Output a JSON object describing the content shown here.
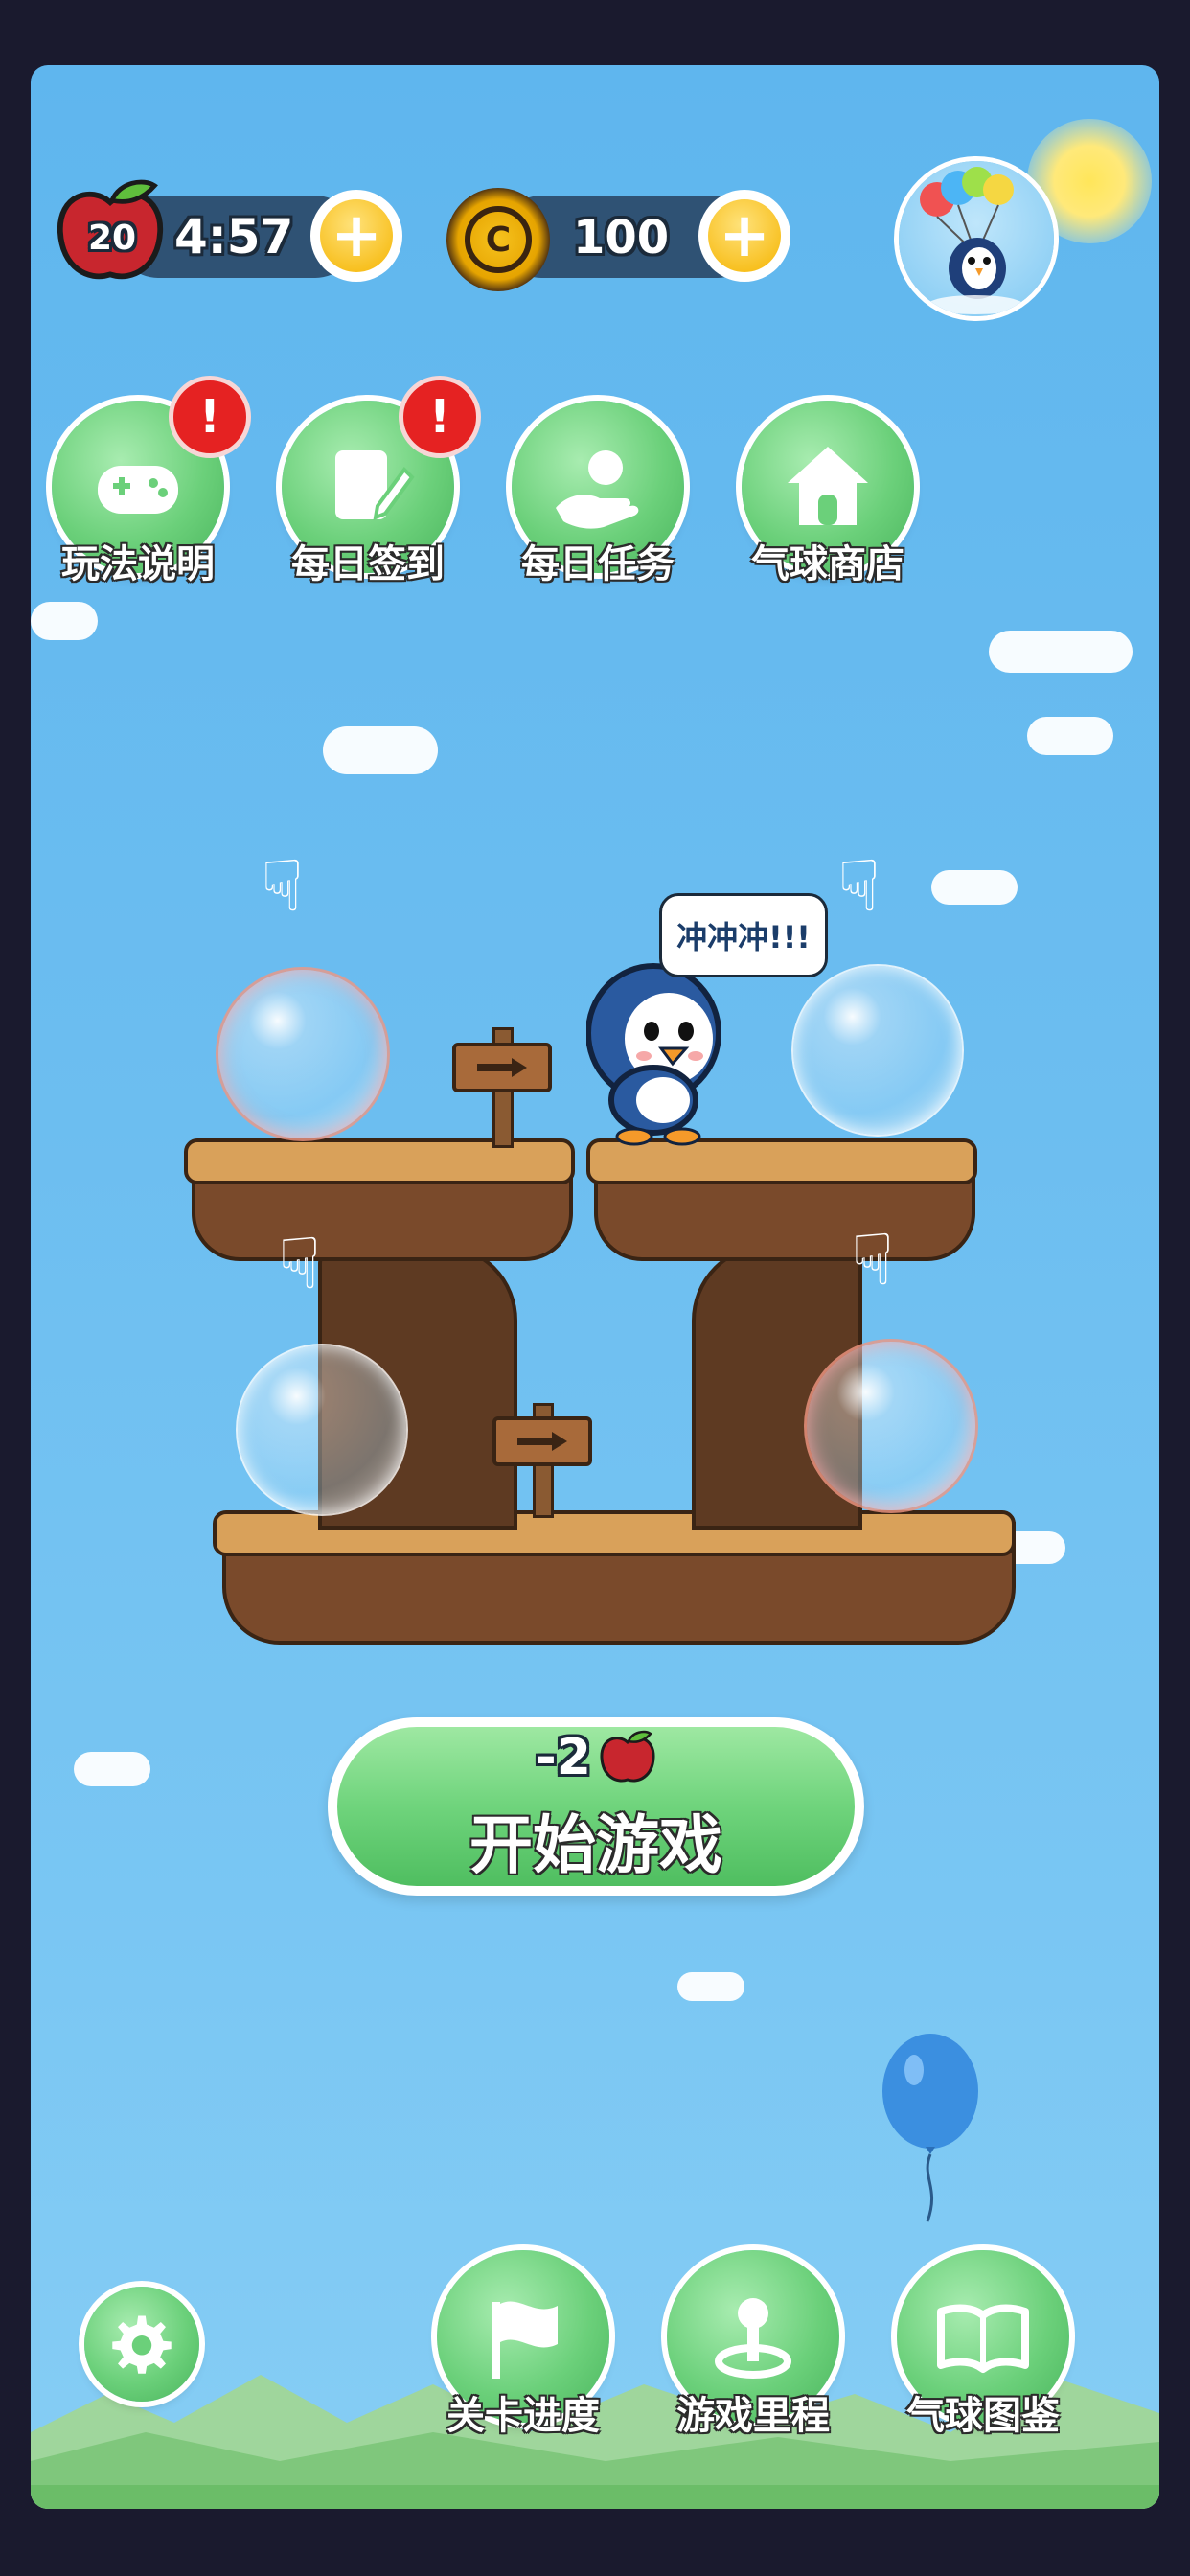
{
  "status_bar": {
    "apples": "20",
    "timer": "4:57",
    "coins": "100"
  },
  "top_menu": [
    {
      "label": "玩法说明",
      "badge": "!"
    },
    {
      "label": "每日签到",
      "badge": "!"
    },
    {
      "label": "每日任务",
      "badge": ""
    },
    {
      "label": "气球商店",
      "badge": ""
    }
  ],
  "speech_bubble": "冲冲冲!!!",
  "start_button": {
    "cost": "-2",
    "label": "开始游戏"
  },
  "bottom_menu": [
    {
      "label": "关卡进度"
    },
    {
      "label": "游戏里程"
    },
    {
      "label": "气球图鉴"
    }
  ],
  "colors": {
    "sky": "#6bbdf0",
    "button_green": "#6bd07a",
    "badge_red": "#e52222",
    "pill_dark": "#2f5274",
    "coin_gold": "#f5b400",
    "balloon_blue": "#3b8fe0"
  }
}
